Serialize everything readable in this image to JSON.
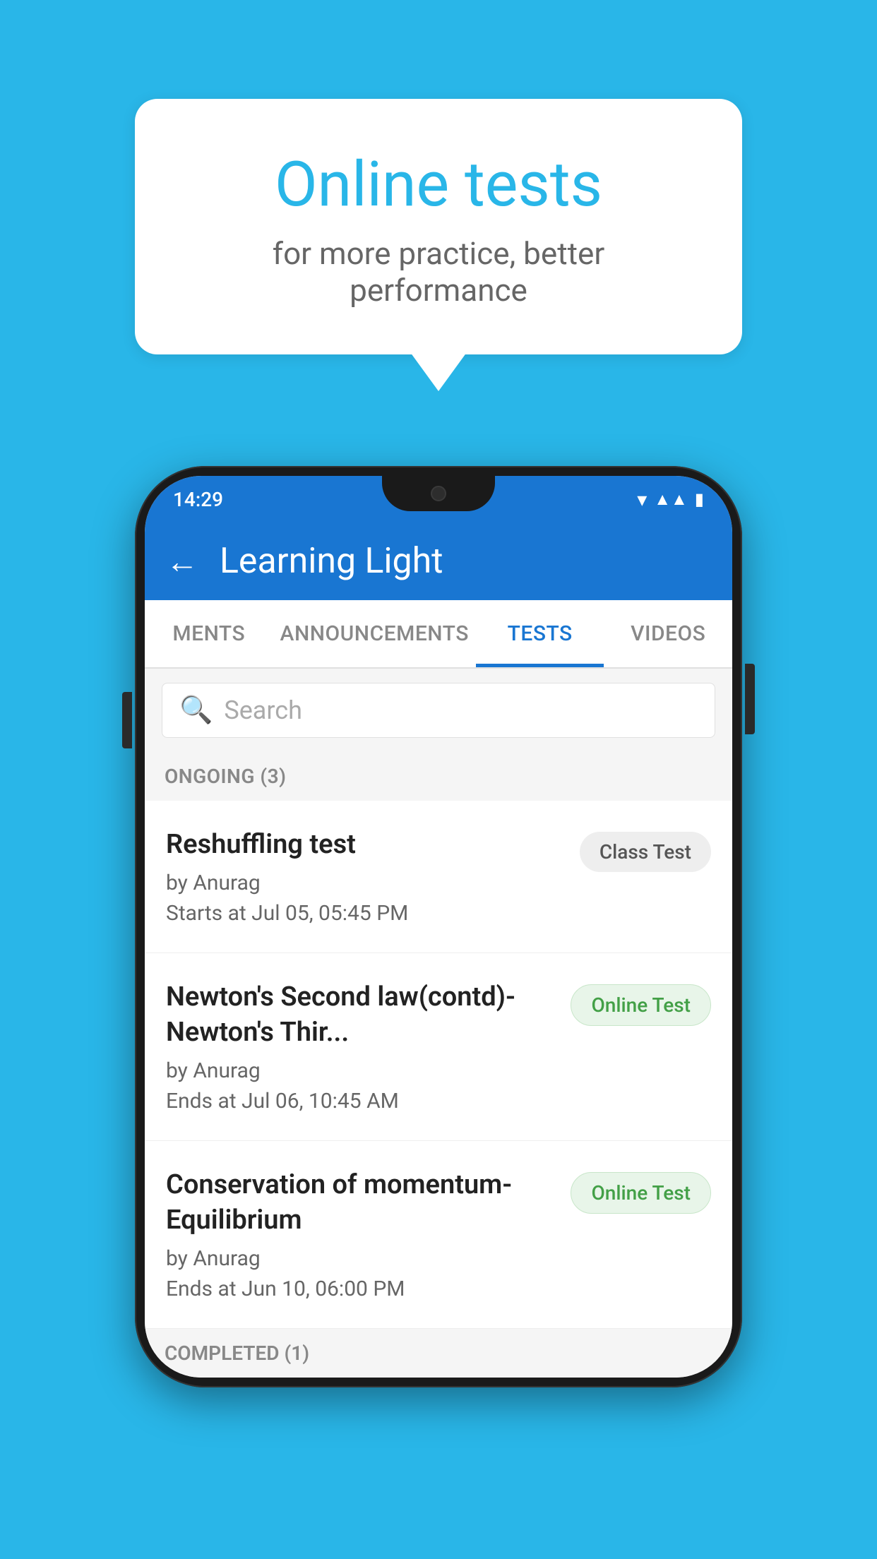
{
  "background": {
    "color": "#29b6e8"
  },
  "speech_bubble": {
    "title": "Online tests",
    "subtitle": "for more practice, better performance"
  },
  "phone": {
    "status_bar": {
      "time": "14:29",
      "wifi": "▾",
      "signal": "▲",
      "battery": "▮"
    },
    "app_bar": {
      "back_label": "←",
      "title": "Learning Light"
    },
    "tabs": [
      {
        "label": "MENTS",
        "active": false
      },
      {
        "label": "ANNOUNCEMENTS",
        "active": false
      },
      {
        "label": "TESTS",
        "active": true
      },
      {
        "label": "VIDEOS",
        "active": false
      }
    ],
    "search": {
      "placeholder": "Search"
    },
    "ongoing_section": {
      "label": "ONGOING (3)"
    },
    "tests": [
      {
        "name": "Reshuffling test",
        "author": "by Anurag",
        "date": "Starts at  Jul 05, 05:45 PM",
        "badge": "Class Test",
        "badge_type": "class"
      },
      {
        "name": "Newton's Second law(contd)-Newton's Thir...",
        "author": "by Anurag",
        "date": "Ends at  Jul 06, 10:45 AM",
        "badge": "Online Test",
        "badge_type": "online"
      },
      {
        "name": "Conservation of momentum-Equilibrium",
        "author": "by Anurag",
        "date": "Ends at  Jun 10, 06:00 PM",
        "badge": "Online Test",
        "badge_type": "online"
      }
    ],
    "completed_section": {
      "label": "COMPLETED (1)"
    }
  }
}
